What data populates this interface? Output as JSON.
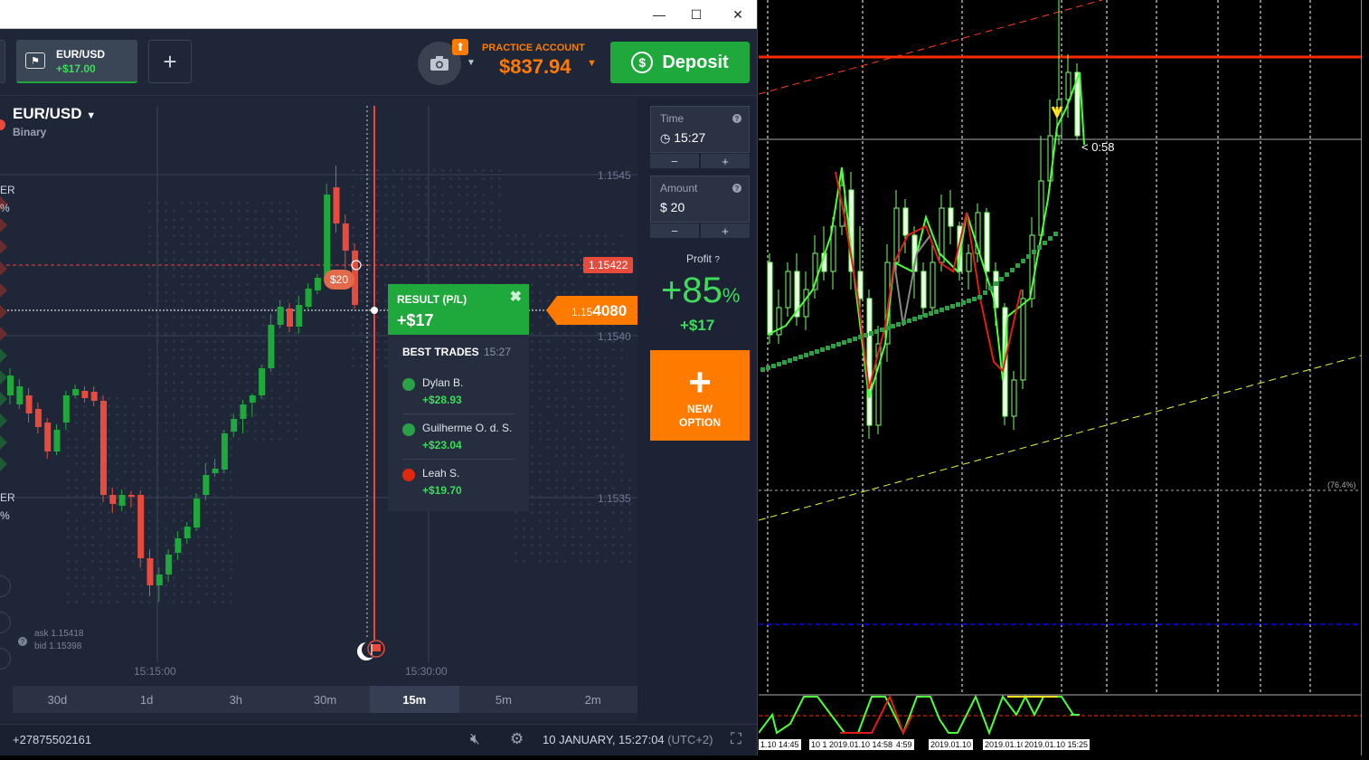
{
  "window": {
    "minimize": "—",
    "maximize": "☐",
    "close": "✕"
  },
  "header": {
    "asset_tab": {
      "name": "EUR/USD",
      "pl": "+$17.00",
      "flag_icon": "flag-icon"
    },
    "add_tab": "+",
    "account_label": "PRACTICE ACCOUNT",
    "balance": "$837.94",
    "deposit_label": "Deposit"
  },
  "chart": {
    "asset_name": "EUR/USD",
    "asset_type": "Binary",
    "price_ticks": [
      "1.1545",
      "1.1540",
      "1.1535"
    ],
    "strike_price": "1.15422",
    "current_price_prefix": "1.15",
    "current_price_main": "4080",
    "bet_amount": "$20",
    "time_ticks": [
      "15:15:00",
      "15:30:00"
    ],
    "ask": "ask 1.15418",
    "bid": "bid 1.15398",
    "left_labels": [
      "ER",
      "%",
      "ER",
      "%"
    ],
    "colors": {
      "up": "#1fa83b",
      "down": "#e84b3c",
      "accent": "#ff7b00"
    }
  },
  "result": {
    "title": "RESULT (P/L)",
    "value": "+$17",
    "close_icon": "close-icon",
    "best_title": "BEST TRADES",
    "best_time": "15:27",
    "traders": [
      {
        "name": "Dylan B.",
        "profit": "+$28.93",
        "flag_color": "#2aa147"
      },
      {
        "name": "Guilherme O. d. S.",
        "profit": "+$23.04",
        "flag_color": "#2aa147"
      },
      {
        "name": "Leah S.",
        "profit": "+$19.70",
        "flag_color": "#de2910"
      }
    ]
  },
  "timeframes": [
    "30d",
    "1d",
    "3h",
    "30m",
    "15m",
    "5m",
    "2m"
  ],
  "active_timeframe": "15m",
  "panel": {
    "time_label": "Time",
    "time_value": "15:27",
    "amount_label": "Amount",
    "amount_value": "$  20",
    "minus": "−",
    "plus": "+",
    "profit_label": "Profit",
    "profit_pct": "+85",
    "profit_pct_sign": "%",
    "profit_amount": "+$17",
    "new_option_plus": "+",
    "new_option_label_1": "NEW",
    "new_option_label_2": "OPTION"
  },
  "footer": {
    "phone": "+27875502161",
    "datetime": "10 JANUARY, 15:27:04",
    "timezone": "(UTC+2)"
  },
  "mt4": {
    "countdown": "< 0:58",
    "fib_label": "(76.4%)",
    "time_labels": [
      "1.10 14:45",
      "10 1",
      "2019.01.10 14:58",
      "4:59",
      "2019.01.10",
      "2019.01.10",
      "2019.01.10 15:25"
    ]
  }
}
